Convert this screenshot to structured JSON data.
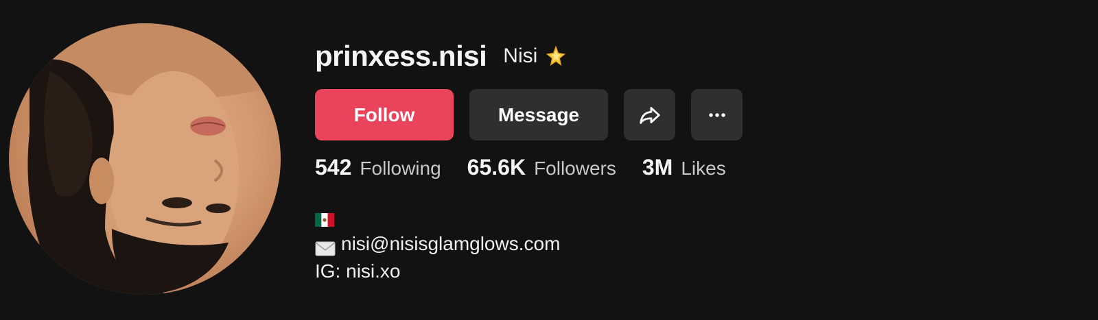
{
  "profile": {
    "username": "prinxess.nisi",
    "nickname": "Nisi",
    "nickname_icon": "star-sparkle-icon",
    "avatar_icon": "profile-photo"
  },
  "actions": {
    "follow_label": "Follow",
    "message_label": "Message",
    "share_icon": "share-arrow-icon",
    "more_icon": "more-dots-icon"
  },
  "stats": {
    "following_count": "542",
    "following_label": "Following",
    "followers_count": "65.6K",
    "followers_label": "Followers",
    "likes_count": "3M",
    "likes_label": "Likes"
  },
  "bio": {
    "flag_icon": "mexico-flag-icon",
    "email": "nisi@nisisglamglows.com",
    "email_icon": "envelope-icon",
    "instagram": "IG: nisi.xo"
  },
  "colors": {
    "background": "#121212",
    "follow_button": "#ea435c",
    "secondary_button": "#2f2f2f",
    "stat_label": "#c8c8c8"
  }
}
